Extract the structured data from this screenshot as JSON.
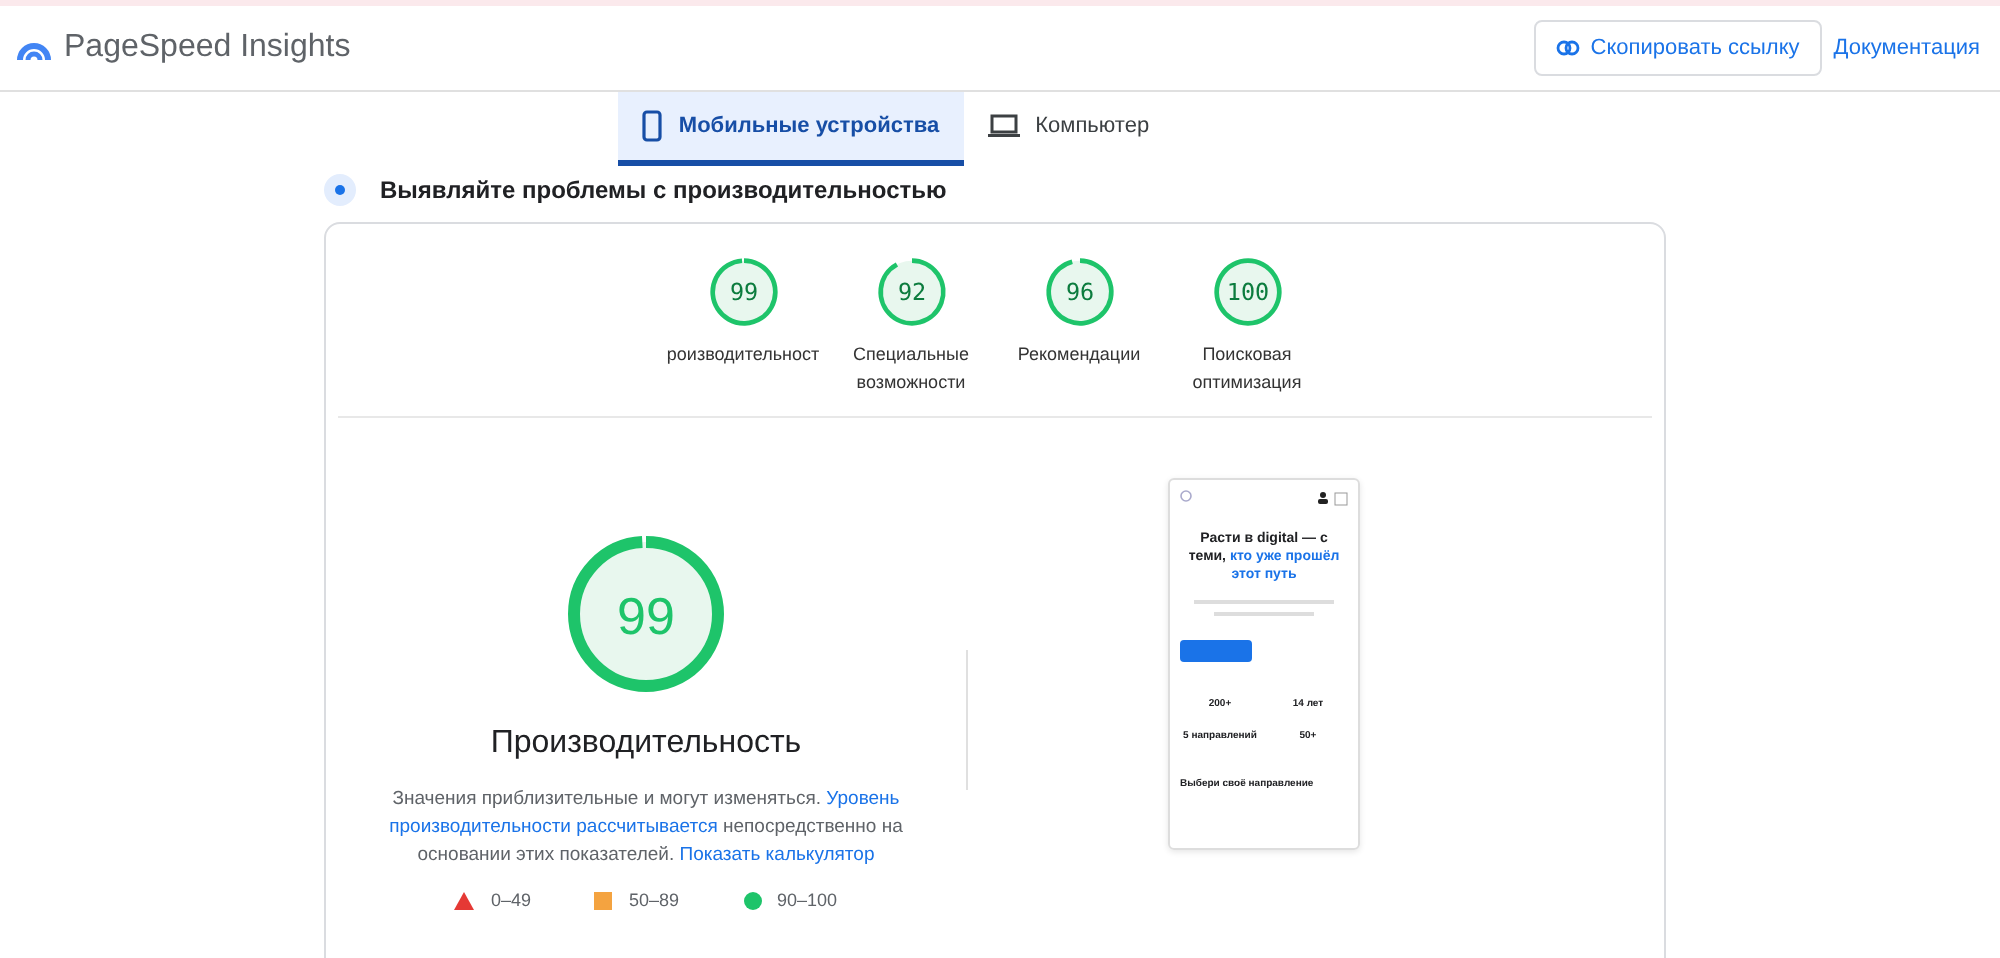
{
  "header": {
    "title": "PageSpeed Insights",
    "copy_button": "Скопировать ссылку",
    "docs_link": "Документация"
  },
  "tabs": [
    {
      "label": "Мобильные устройства",
      "kind": "phone",
      "selected": true
    },
    {
      "label": "Компьютер",
      "kind": "laptop",
      "selected": false
    }
  ],
  "notice": "Выявляйте проблемы с производительностью",
  "categories": [
    {
      "score": "99",
      "level": 0.99,
      "label": "роизводительност"
    },
    {
      "score": "92",
      "level": 0.92,
      "label": "Специальные возможности"
    },
    {
      "score": "96",
      "level": 0.96,
      "label": "Рекомендации"
    },
    {
      "score": "100",
      "level": 1,
      "label": "Поисковая оптимизация"
    }
  ],
  "main_gauge": {
    "score": "99",
    "level": 0.99,
    "title": "Производительность"
  },
  "description": [
    {
      "text": "Значения приблизительные и могут изменяться.",
      "link": false
    },
    {
      "text": "Уровень",
      "link": true
    },
    {
      "text": "производительности рассчитывается",
      "link": true
    },
    {
      "text": "непосредственно на",
      "link": false
    },
    {
      "text": "основании этих показателей.",
      "link": false
    },
    {
      "text": "Показать калькулятор",
      "link": true
    }
  ],
  "legend": [
    {
      "kind": "triangle",
      "color": "#e53935",
      "range": "0–49"
    },
    {
      "kind": "square",
      "color": "#f4a340",
      "range": "50–89"
    },
    {
      "kind": "circle",
      "color": "#1ec46a",
      "range": "90–100"
    }
  ],
  "screenshot": {
    "headline": "Расти в digital — с теми,",
    "headline_accent": "кто уже прошёл этот путь",
    "stats": [
      "200+",
      "14 лет",
      "5 направлений",
      "50+"
    ],
    "section": "Выбери своё направление"
  }
}
